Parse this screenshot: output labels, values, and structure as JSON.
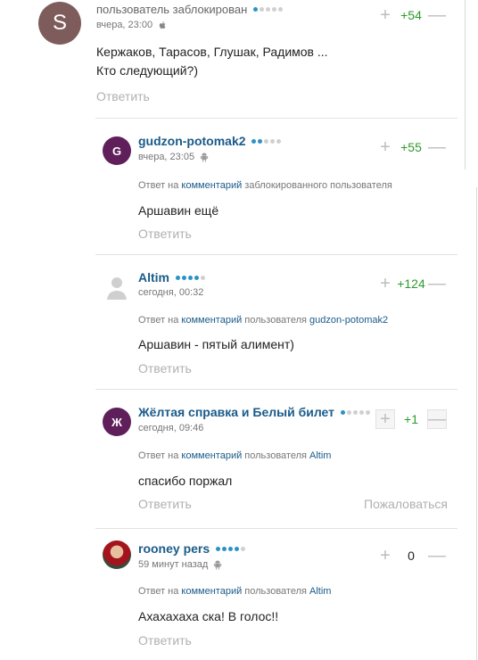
{
  "top_comment": {
    "avatar_letter": "S",
    "author": "пользователь заблокирован",
    "time": "вчера, 23:00",
    "device_icon": "apple-icon",
    "votes": "+54",
    "text_line1": "Кержаков, Тарасов, Глушак, Радимов ...",
    "text_line2": "Кто следующий?)",
    "reply_label": "Ответить"
  },
  "replies": [
    {
      "avatar_letter": "G",
      "author": "gudzon-potomak2",
      "time": "вчера, 23:05",
      "device_icon": "android-icon",
      "votes": "+55",
      "reply_prefix": "Ответ на",
      "reply_link": "комментарий",
      "reply_suffix": "заблокированного пользователя",
      "text": "Аршавин ещё",
      "reply_label": "Ответить"
    },
    {
      "avatar_letter": "",
      "author": "Altim",
      "time": "сегодня, 00:32",
      "votes": "+124",
      "reply_prefix": "Ответ на",
      "reply_link": "комментарий",
      "reply_suffix": "пользователя",
      "reply_user": "gudzon-potomak2",
      "text": "Аршавин - пятый алимент)",
      "reply_label": "Ответить"
    },
    {
      "avatar_letter": "Ж",
      "author": "Жёлтая справка и Белый билет",
      "time": "сегодня, 09:46",
      "votes": "+1",
      "reply_prefix": "Ответ на",
      "reply_link": "комментарий",
      "reply_suffix": "пользователя",
      "reply_user": "Altim",
      "text": "спасибо поржал",
      "reply_label": "Ответить",
      "report_label": "Пожаловаться"
    },
    {
      "avatar_letter": "",
      "author": "rooney pers",
      "time": "59 минут назад",
      "device_icon": "android-icon",
      "votes": "0",
      "reply_prefix": "Ответ на",
      "reply_link": "комментарий",
      "reply_suffix": "пользователя",
      "reply_user": "Altim",
      "text": "Ахахахаха ска! В голос!!",
      "reply_label": "Ответить"
    }
  ],
  "vote_plus": "+",
  "vote_minus": "—",
  "colors": {
    "username": "#1a5b8a",
    "positive": "#2c9b2c",
    "muted": "#b0b0b0",
    "rating_dot": "#2a93c4"
  }
}
